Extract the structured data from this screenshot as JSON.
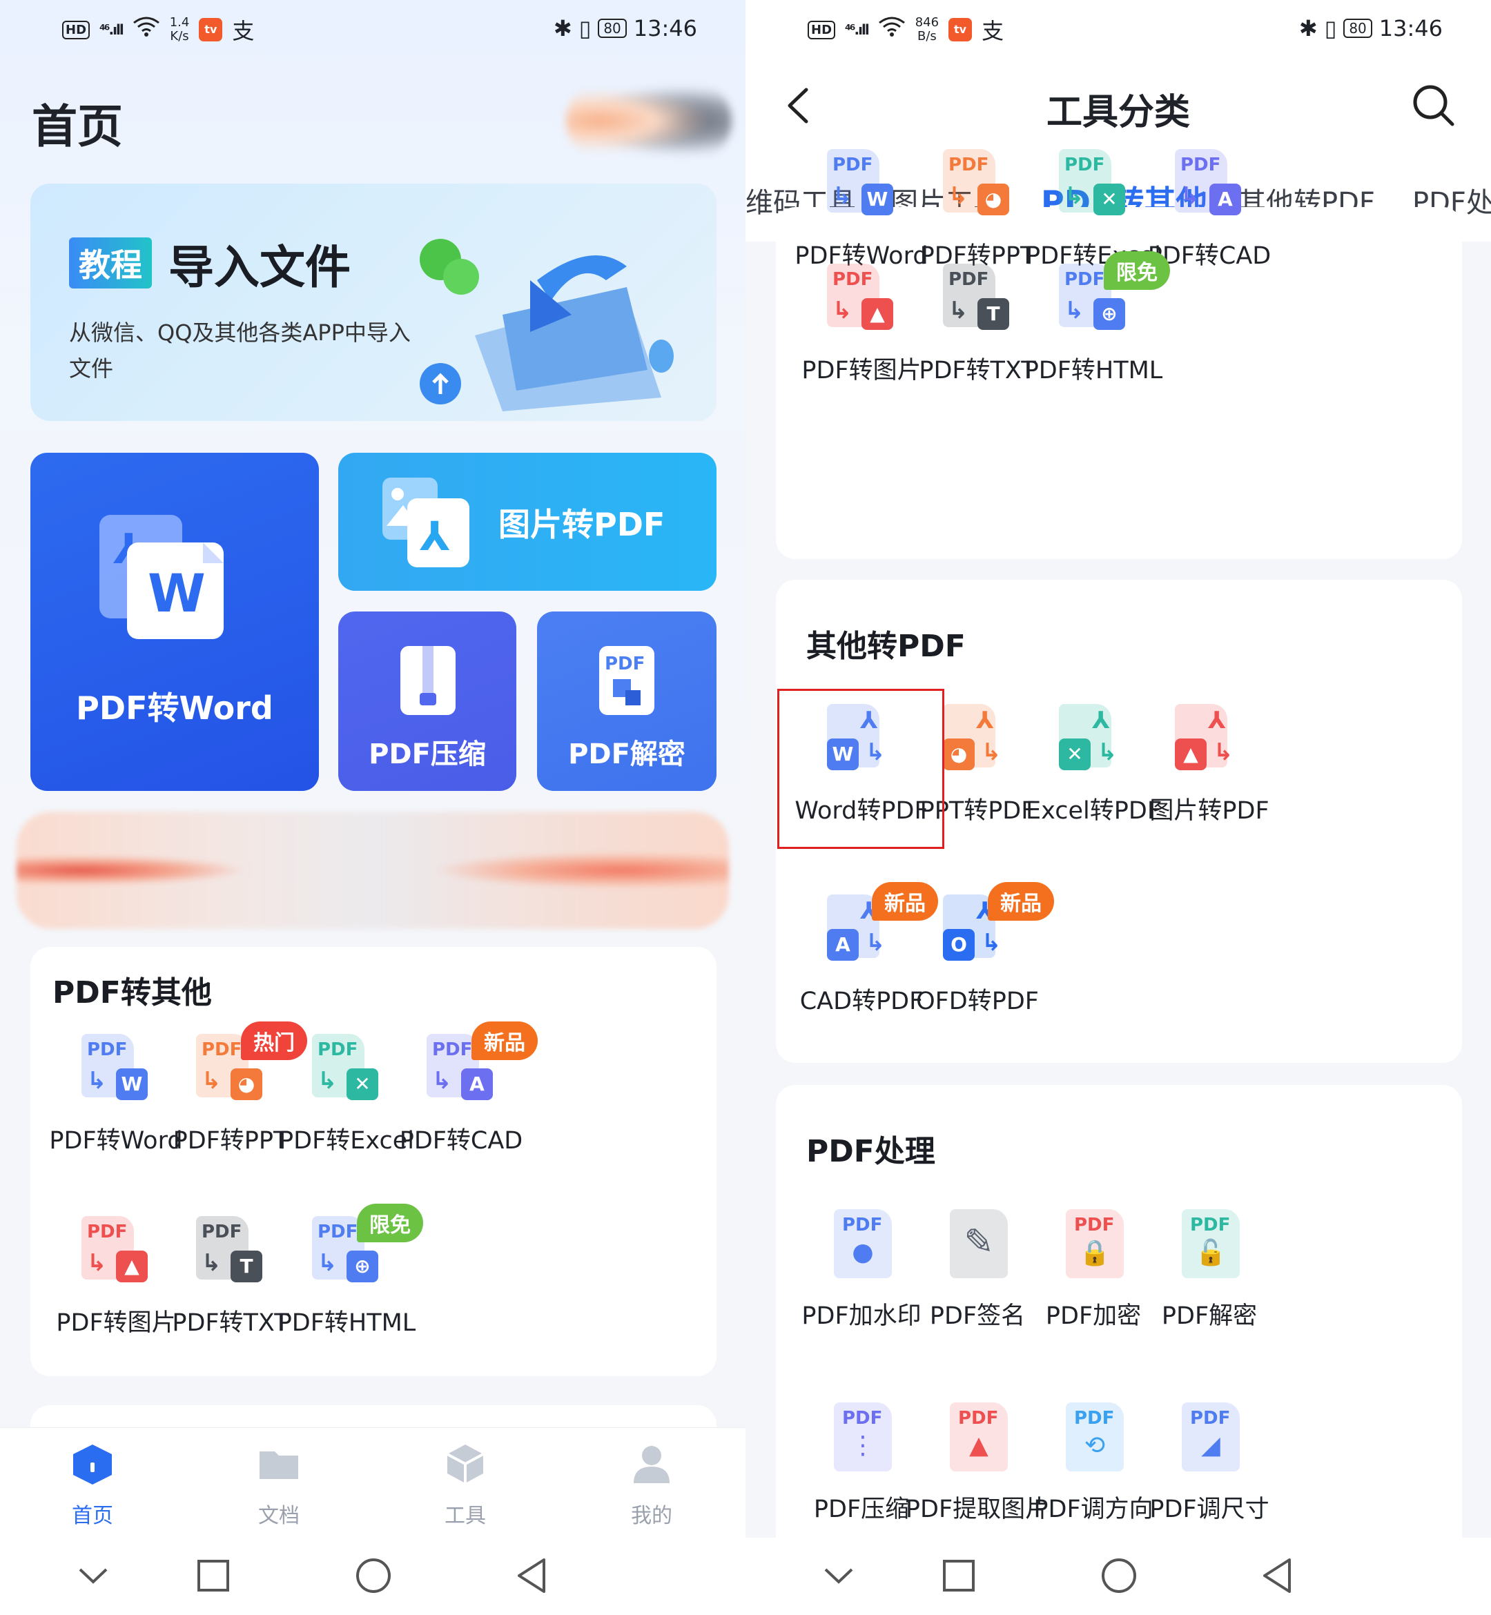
{
  "left": {
    "status": {
      "hd": "HD",
      "signal": "⁴⁶.ıll",
      "speed_top": "1.4",
      "speed_bottom": "K/s",
      "app_icon": "tv-app-icon",
      "time": "13:46",
      "battery": "80",
      "extra": "支"
    },
    "page_title": "首页",
    "banner": {
      "tag": "教程",
      "title": "导入文件",
      "subtitle": "从微信、QQ及其他各类APP中导入文件"
    },
    "tiles": {
      "pdf_to_word": "PDF转Word",
      "img_to_pdf": "图片转PDF",
      "pdf_compress": "PDF压缩",
      "pdf_decrypt": "PDF解密"
    },
    "section_title": "PDF转其他",
    "tools": [
      {
        "label": "PDF转Word",
        "sub": "W",
        "color": "#4f7cf0"
      },
      {
        "label": "PDF转PPT",
        "sub": "◕",
        "color": "#f37a3a",
        "badge": "热门"
      },
      {
        "label": "PDF转Excel",
        "sub": "✕",
        "color": "#2db8a1"
      },
      {
        "label": "PDF转CAD",
        "sub": "A",
        "color": "#6b6ff0",
        "badge": "新品"
      },
      {
        "label": "PDF转图片",
        "sub": "▲",
        "color": "#ee5050"
      },
      {
        "label": "PDF转TXT",
        "sub": "T",
        "color": "#4a5058"
      },
      {
        "label": "PDF转HTML",
        "sub": "⊕",
        "color": "#4f7cf0",
        "badge": "限免"
      }
    ],
    "nav": [
      {
        "label": "首页",
        "active": true
      },
      {
        "label": "文档"
      },
      {
        "label": "工具"
      },
      {
        "label": "我的"
      }
    ]
  },
  "right": {
    "status": {
      "hd": "HD",
      "signal": "⁴⁶.ıll",
      "speed_top": "846",
      "speed_bottom": "B/s",
      "time": "13:46",
      "battery": "80",
      "extra": "支"
    },
    "title": "工具分类",
    "tabs": [
      "维码工具",
      "图片工具",
      "PDF转其他",
      "其他转PDF",
      "PDF处"
    ],
    "pdf_to_other": [
      {
        "label": "PDF转Word",
        "sub": "W",
        "color": "#4f7cf0"
      },
      {
        "label": "PDF转PPT",
        "sub": "◕",
        "color": "#f37a3a"
      },
      {
        "label": "PDF转Excel",
        "sub": "✕",
        "color": "#2db8a1"
      },
      {
        "label": "PDF转CAD",
        "sub": "A",
        "color": "#6b6ff0"
      },
      {
        "label": "PDF转图片",
        "sub": "▲",
        "color": "#ee5050"
      },
      {
        "label": "PDF转TXT",
        "sub": "T",
        "color": "#4a5058"
      },
      {
        "label": "PDF转HTML",
        "sub": "⊕",
        "color": "#4f7cf0",
        "badge": "限免"
      }
    ],
    "other_to_pdf_title": "其他转PDF",
    "other_to_pdf": [
      {
        "label": "Word转PDF",
        "sub": "W",
        "color": "#4f7cf0"
      },
      {
        "label": "PPT转PDF",
        "sub": "◕",
        "color": "#f37a3a"
      },
      {
        "label": "Excel转PDF",
        "sub": "✕",
        "color": "#2db8a1"
      },
      {
        "label": "图片转PDF",
        "sub": "▲",
        "color": "#ee5050"
      },
      {
        "label": "CAD转PDF",
        "sub": "A",
        "color": "#4f7cf0",
        "badge": "新品"
      },
      {
        "label": "OFD转PDF",
        "sub": "O",
        "color": "#2b6df0",
        "badge": "新品"
      }
    ],
    "pdf_process_title": "PDF处理",
    "pdf_process": [
      {
        "label": "PDF加水印"
      },
      {
        "label": "PDF签名"
      },
      {
        "label": "PDF加密"
      },
      {
        "label": "PDF解密"
      },
      {
        "label": "PDF压缩"
      },
      {
        "label": "PDF提取图片"
      },
      {
        "label": "PDF调方向"
      },
      {
        "label": "PDF调尺寸"
      }
    ]
  },
  "pdf_text": "PDF",
  "colors": {
    "accent": "#2b6df0",
    "highlight": "#e02020",
    "badge_new": "#f5701e",
    "badge_free": "#6cc243",
    "badge_hot": "#f0433a"
  }
}
